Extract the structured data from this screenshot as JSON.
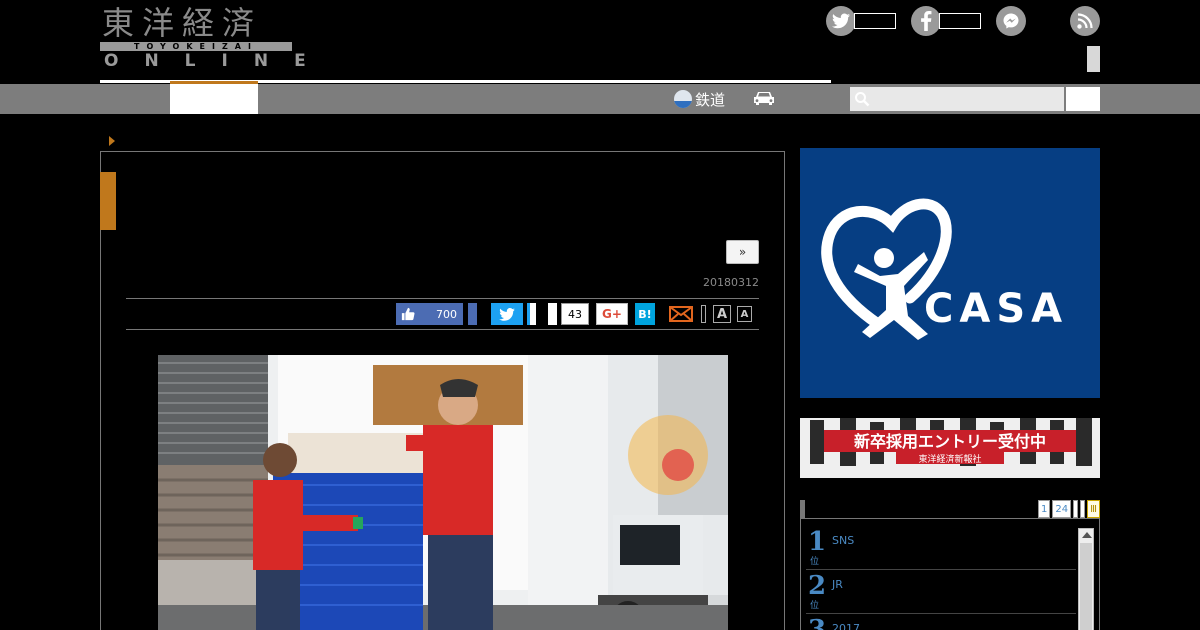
{
  "header": {
    "logo_kanji": "東洋経済",
    "logo_romaji": "TOYOKEIZAI",
    "logo_online": "ONLINE"
  },
  "nav": {
    "rail_label": "鉄道",
    "search": {
      "placeholder": "",
      "value": ""
    }
  },
  "article": {
    "next_label": "»",
    "date": "20180312",
    "share": {
      "like_count": "700",
      "pocket_count": "43",
      "gplus_label": "G+",
      "hatena_label": "B!",
      "font_large_label": "A",
      "font_small_label": "A"
    }
  },
  "sidebar": {
    "casa_ad": {
      "brand": "CASA",
      "mark": "®"
    },
    "recruit_ad": {
      "headline": "新卒採用エントリー受付中",
      "company": "東洋経済新報社"
    },
    "ranking": {
      "tabs": [
        "1",
        "24",
        "",
        "",
        "Ⅲ"
      ],
      "items": [
        {
          "rank": "1",
          "unit": "位",
          "title": "SNS"
        },
        {
          "rank": "2",
          "unit": "位",
          "title": "JR"
        },
        {
          "rank": "3",
          "unit": "位",
          "title": "2017"
        }
      ]
    }
  },
  "colors": {
    "accent_orange": "#c0781c",
    "facebook_blue": "#4c6cb3",
    "twitter_blue": "#1da1f2",
    "hatena_blue": "#00a4de",
    "casa_navy": "#063e83",
    "ranking_blue": "#4a8ac4"
  }
}
